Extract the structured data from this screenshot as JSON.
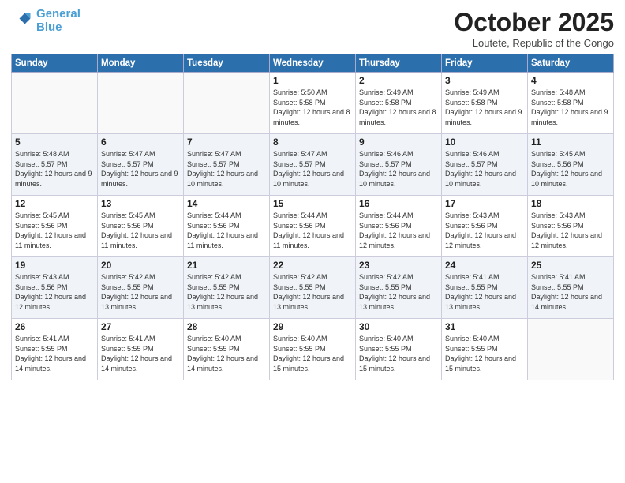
{
  "header": {
    "logo_line1": "General",
    "logo_line2": "Blue",
    "month_title": "October 2025",
    "location": "Loutete, Republic of the Congo"
  },
  "weekdays": [
    "Sunday",
    "Monday",
    "Tuesday",
    "Wednesday",
    "Thursday",
    "Friday",
    "Saturday"
  ],
  "weeks": [
    [
      {
        "day": "",
        "sunrise": "",
        "sunset": "",
        "daylight": ""
      },
      {
        "day": "",
        "sunrise": "",
        "sunset": "",
        "daylight": ""
      },
      {
        "day": "",
        "sunrise": "",
        "sunset": "",
        "daylight": ""
      },
      {
        "day": "1",
        "sunrise": "Sunrise: 5:50 AM",
        "sunset": "Sunset: 5:58 PM",
        "daylight": "Daylight: 12 hours and 8 minutes."
      },
      {
        "day": "2",
        "sunrise": "Sunrise: 5:49 AM",
        "sunset": "Sunset: 5:58 PM",
        "daylight": "Daylight: 12 hours and 8 minutes."
      },
      {
        "day": "3",
        "sunrise": "Sunrise: 5:49 AM",
        "sunset": "Sunset: 5:58 PM",
        "daylight": "Daylight: 12 hours and 9 minutes."
      },
      {
        "day": "4",
        "sunrise": "Sunrise: 5:48 AM",
        "sunset": "Sunset: 5:58 PM",
        "daylight": "Daylight: 12 hours and 9 minutes."
      }
    ],
    [
      {
        "day": "5",
        "sunrise": "Sunrise: 5:48 AM",
        "sunset": "Sunset: 5:57 PM",
        "daylight": "Daylight: 12 hours and 9 minutes."
      },
      {
        "day": "6",
        "sunrise": "Sunrise: 5:47 AM",
        "sunset": "Sunset: 5:57 PM",
        "daylight": "Daylight: 12 hours and 9 minutes."
      },
      {
        "day": "7",
        "sunrise": "Sunrise: 5:47 AM",
        "sunset": "Sunset: 5:57 PM",
        "daylight": "Daylight: 12 hours and 10 minutes."
      },
      {
        "day": "8",
        "sunrise": "Sunrise: 5:47 AM",
        "sunset": "Sunset: 5:57 PM",
        "daylight": "Daylight: 12 hours and 10 minutes."
      },
      {
        "day": "9",
        "sunrise": "Sunrise: 5:46 AM",
        "sunset": "Sunset: 5:57 PM",
        "daylight": "Daylight: 12 hours and 10 minutes."
      },
      {
        "day": "10",
        "sunrise": "Sunrise: 5:46 AM",
        "sunset": "Sunset: 5:57 PM",
        "daylight": "Daylight: 12 hours and 10 minutes."
      },
      {
        "day": "11",
        "sunrise": "Sunrise: 5:45 AM",
        "sunset": "Sunset: 5:56 PM",
        "daylight": "Daylight: 12 hours and 10 minutes."
      }
    ],
    [
      {
        "day": "12",
        "sunrise": "Sunrise: 5:45 AM",
        "sunset": "Sunset: 5:56 PM",
        "daylight": "Daylight: 12 hours and 11 minutes."
      },
      {
        "day": "13",
        "sunrise": "Sunrise: 5:45 AM",
        "sunset": "Sunset: 5:56 PM",
        "daylight": "Daylight: 12 hours and 11 minutes."
      },
      {
        "day": "14",
        "sunrise": "Sunrise: 5:44 AM",
        "sunset": "Sunset: 5:56 PM",
        "daylight": "Daylight: 12 hours and 11 minutes."
      },
      {
        "day": "15",
        "sunrise": "Sunrise: 5:44 AM",
        "sunset": "Sunset: 5:56 PM",
        "daylight": "Daylight: 12 hours and 11 minutes."
      },
      {
        "day": "16",
        "sunrise": "Sunrise: 5:44 AM",
        "sunset": "Sunset: 5:56 PM",
        "daylight": "Daylight: 12 hours and 12 minutes."
      },
      {
        "day": "17",
        "sunrise": "Sunrise: 5:43 AM",
        "sunset": "Sunset: 5:56 PM",
        "daylight": "Daylight: 12 hours and 12 minutes."
      },
      {
        "day": "18",
        "sunrise": "Sunrise: 5:43 AM",
        "sunset": "Sunset: 5:56 PM",
        "daylight": "Daylight: 12 hours and 12 minutes."
      }
    ],
    [
      {
        "day": "19",
        "sunrise": "Sunrise: 5:43 AM",
        "sunset": "Sunset: 5:56 PM",
        "daylight": "Daylight: 12 hours and 12 minutes."
      },
      {
        "day": "20",
        "sunrise": "Sunrise: 5:42 AM",
        "sunset": "Sunset: 5:55 PM",
        "daylight": "Daylight: 12 hours and 13 minutes."
      },
      {
        "day": "21",
        "sunrise": "Sunrise: 5:42 AM",
        "sunset": "Sunset: 5:55 PM",
        "daylight": "Daylight: 12 hours and 13 minutes."
      },
      {
        "day": "22",
        "sunrise": "Sunrise: 5:42 AM",
        "sunset": "Sunset: 5:55 PM",
        "daylight": "Daylight: 12 hours and 13 minutes."
      },
      {
        "day": "23",
        "sunrise": "Sunrise: 5:42 AM",
        "sunset": "Sunset: 5:55 PM",
        "daylight": "Daylight: 12 hours and 13 minutes."
      },
      {
        "day": "24",
        "sunrise": "Sunrise: 5:41 AM",
        "sunset": "Sunset: 5:55 PM",
        "daylight": "Daylight: 12 hours and 13 minutes."
      },
      {
        "day": "25",
        "sunrise": "Sunrise: 5:41 AM",
        "sunset": "Sunset: 5:55 PM",
        "daylight": "Daylight: 12 hours and 14 minutes."
      }
    ],
    [
      {
        "day": "26",
        "sunrise": "Sunrise: 5:41 AM",
        "sunset": "Sunset: 5:55 PM",
        "daylight": "Daylight: 12 hours and 14 minutes."
      },
      {
        "day": "27",
        "sunrise": "Sunrise: 5:41 AM",
        "sunset": "Sunset: 5:55 PM",
        "daylight": "Daylight: 12 hours and 14 minutes."
      },
      {
        "day": "28",
        "sunrise": "Sunrise: 5:40 AM",
        "sunset": "Sunset: 5:55 PM",
        "daylight": "Daylight: 12 hours and 14 minutes."
      },
      {
        "day": "29",
        "sunrise": "Sunrise: 5:40 AM",
        "sunset": "Sunset: 5:55 PM",
        "daylight": "Daylight: 12 hours and 15 minutes."
      },
      {
        "day": "30",
        "sunrise": "Sunrise: 5:40 AM",
        "sunset": "Sunset: 5:55 PM",
        "daylight": "Daylight: 12 hours and 15 minutes."
      },
      {
        "day": "31",
        "sunrise": "Sunrise: 5:40 AM",
        "sunset": "Sunset: 5:55 PM",
        "daylight": "Daylight: 12 hours and 15 minutes."
      },
      {
        "day": "",
        "sunrise": "",
        "sunset": "",
        "daylight": ""
      }
    ]
  ]
}
